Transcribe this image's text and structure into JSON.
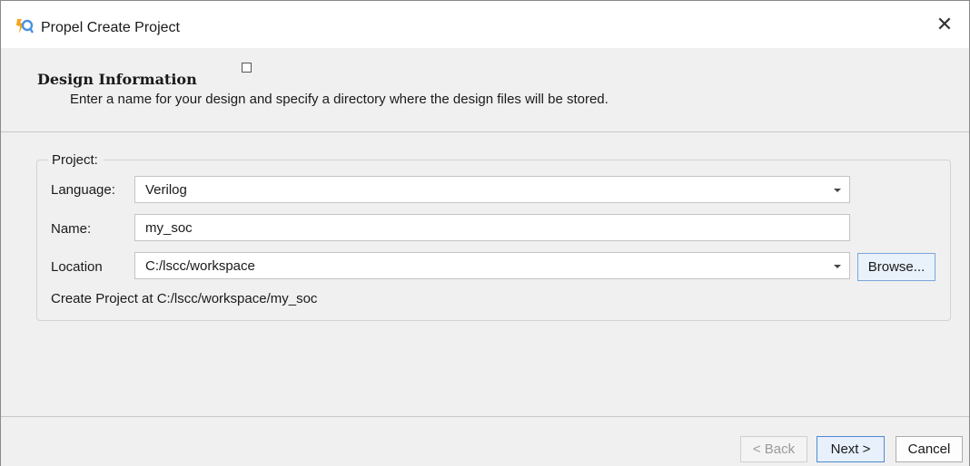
{
  "window": {
    "title": "Propel Create Project",
    "close_glyph": "✕",
    "icon": "propel-app-icon"
  },
  "header": {
    "title": "Design Information",
    "subtitle": "Enter a name for your design and specify a directory where the design files will be stored."
  },
  "project": {
    "group_label": "Project:",
    "language": {
      "label": "Language:",
      "value": "Verilog"
    },
    "name": {
      "label": "Name:",
      "value": "my_soc"
    },
    "location": {
      "label": "Location",
      "value": "C:/lscc/workspace",
      "browse_label": "Browse..."
    },
    "create_path": "Create Project at C:/lscc/workspace/my_soc"
  },
  "footer": {
    "back_label": "< Back",
    "next_label": "Next >",
    "cancel_label": "Cancel"
  },
  "colors": {
    "accent": "#4d8ad6",
    "background": "#f0f0f0"
  }
}
